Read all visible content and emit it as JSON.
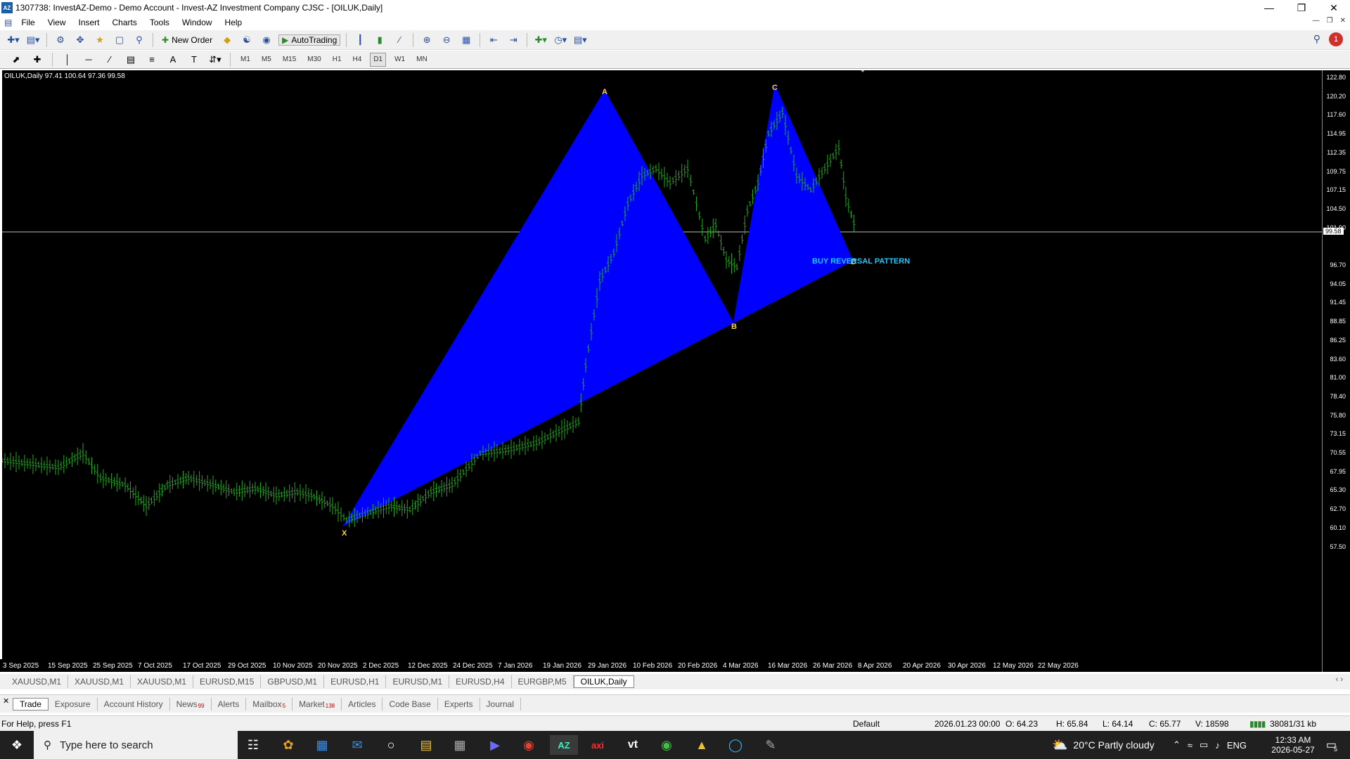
{
  "window": {
    "title": "1307738: InvestAZ-Demo - Demo Account - Invest-AZ Investment Company CJSC - [OILUK,Daily]",
    "app_icon": "AZ"
  },
  "menu": [
    "File",
    "View",
    "Insert",
    "Charts",
    "Tools",
    "Window",
    "Help"
  ],
  "toolbar": {
    "new_order": "New Order",
    "autotrading": "AutoTrading",
    "timeframes": [
      "M1",
      "M5",
      "M15",
      "M30",
      "H1",
      "H4",
      "D1",
      "W1",
      "MN"
    ],
    "active_timeframe": "D1",
    "notification_count": "1"
  },
  "chart": {
    "symbol_label": "OILUK,Daily  97.41 100.64 97.36 99.58",
    "pattern_points": {
      "x": "X",
      "a": "A",
      "b": "B",
      "c": "C",
      "d": "D"
    },
    "pattern_label": "BUY REVERSAL PATTERN",
    "pattern_color": "#0000ff",
    "candle_color": "#22aa22",
    "current_price": "99.58",
    "price_labels": [
      "122.80",
      "120.20",
      "117.60",
      "114.95",
      "112.35",
      "109.75",
      "107.15",
      "104.50",
      "101.90",
      "96.70",
      "94.05",
      "91.45",
      "88.85",
      "86.25",
      "83.60",
      "81.00",
      "78.40",
      "75.80",
      "73.15",
      "70.55",
      "67.95",
      "65.30",
      "62.70",
      "60.10",
      "57.50"
    ],
    "time_labels": [
      "3 Sep 2025",
      "15 Sep 2025",
      "25 Sep 2025",
      "7 Oct 2025",
      "17 Oct 2025",
      "29 Oct 2025",
      "10 Nov 2025",
      "20 Nov 2025",
      "2 Dec 2025",
      "12 Dec 2025",
      "24 Dec 2025",
      "7 Jan 2026",
      "19 Jan 2026",
      "29 Jan 2026",
      "10 Feb 2026",
      "20 Feb 2026",
      "4 Mar 2026",
      "16 Mar 2026",
      "26 Mar 2026",
      "8 Apr 2026",
      "20 Apr 2026",
      "30 Apr 2026",
      "12 May 2026",
      "22 May 2026"
    ]
  },
  "chart_tabs": [
    "XAUUSD,M1",
    "XAUUSD,M1",
    "XAUUSD,M1",
    "EURUSD,M15",
    "GBPUSD,M1",
    "EURUSD,H1",
    "EURUSD,M1",
    "EURUSD,H4",
    "EURGBP,M5",
    "OILUK,Daily"
  ],
  "active_chart_tab": "OILUK,Daily",
  "terminal_tabs": [
    {
      "label": "Trade",
      "badge": ""
    },
    {
      "label": "Exposure",
      "badge": ""
    },
    {
      "label": "Account History",
      "badge": ""
    },
    {
      "label": "News",
      "badge": "99"
    },
    {
      "label": "Alerts",
      "badge": ""
    },
    {
      "label": "Mailbox",
      "badge": "5"
    },
    {
      "label": "Market",
      "badge": "138"
    },
    {
      "label": "Articles",
      "badge": ""
    },
    {
      "label": "Code Base",
      "badge": ""
    },
    {
      "label": "Experts",
      "badge": ""
    },
    {
      "label": "Journal",
      "badge": ""
    }
  ],
  "status": {
    "help": "For Help, press F1",
    "profile": "Default",
    "datetime": "2026.01.23 00:00",
    "open": "O: 64.23",
    "high": "H: 65.84",
    "low": "L: 64.14",
    "close": "C: 65.77",
    "volume": "V: 18598",
    "traffic": "38081/31 kb"
  },
  "taskbar": {
    "search_placeholder": "Type here to search",
    "weather": "20°C  Partly cloudy",
    "lang": "ENG",
    "time": "12:33 AM",
    "date": "2026-05-27",
    "notif_count": "5"
  }
}
